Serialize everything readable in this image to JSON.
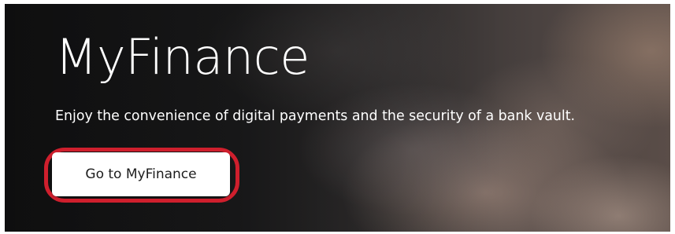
{
  "hero": {
    "title": "MyFinance",
    "tagline": "Enjoy the convenience of digital payments and the security of a bank vault.",
    "cta_label": "Go to MyFinance",
    "highlight_color": "#cf1f2d",
    "background_image": "dark photo of a hand"
  }
}
